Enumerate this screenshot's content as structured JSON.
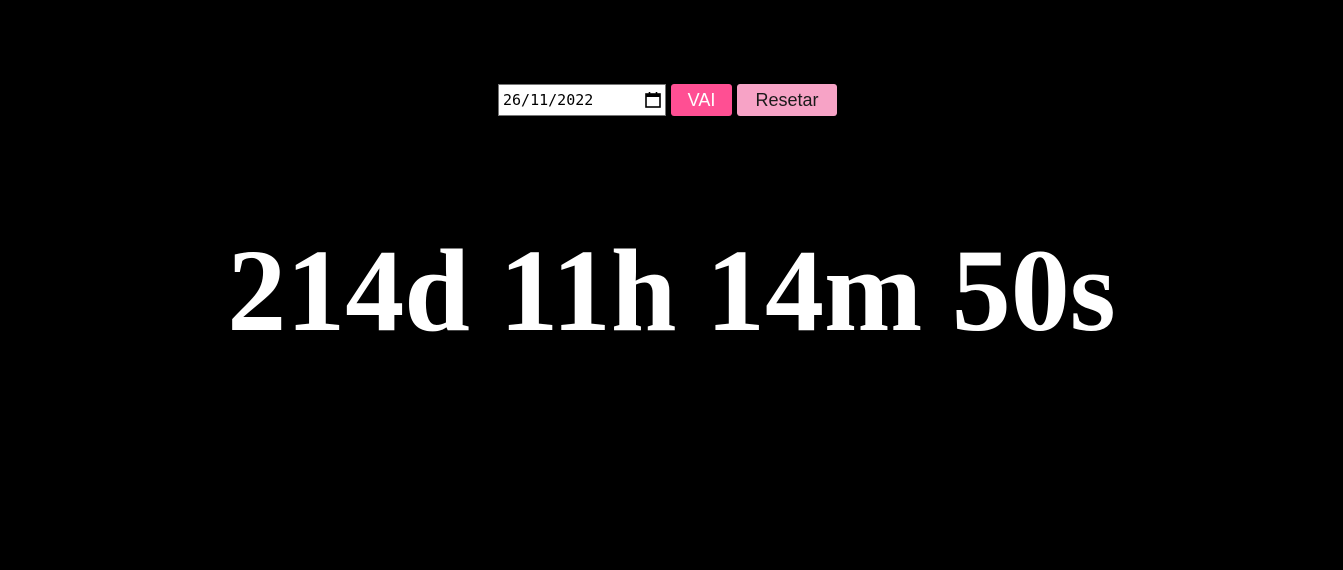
{
  "form": {
    "date_value": "26/11/2022",
    "go_label": "VAI",
    "reset_label": "Resetar"
  },
  "countdown": {
    "display": "214d 11h 14m 50s"
  },
  "colors": {
    "background": "#000000",
    "go_button": "#ff4f93",
    "reset_button": "#f7a3c6",
    "countdown_text": "#ffffff"
  },
  "icons": {
    "date_picker": "calendar-icon"
  }
}
